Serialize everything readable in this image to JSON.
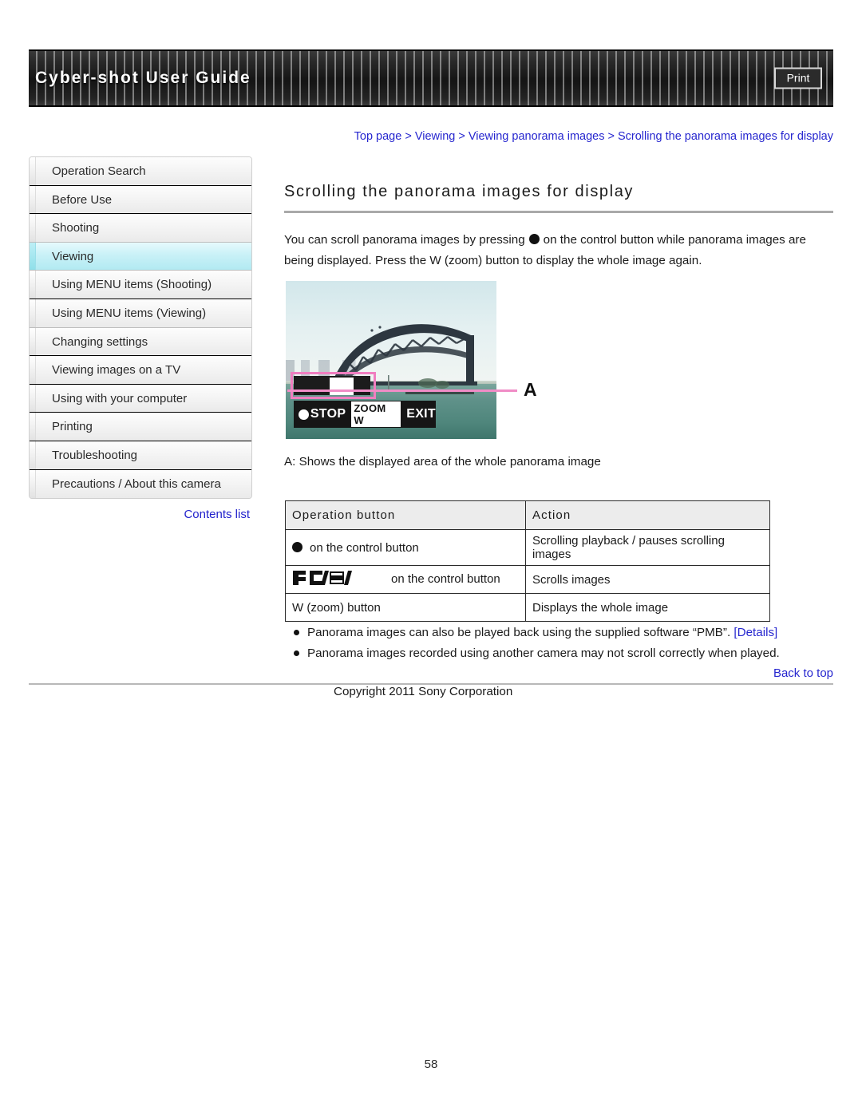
{
  "header": {
    "title": "Cyber-shot User Guide",
    "print_label": "Print"
  },
  "sidebar": {
    "items": [
      {
        "label": "Operation Search",
        "active": false
      },
      {
        "label": "Before Use",
        "active": false
      },
      {
        "label": "Shooting",
        "active": false
      },
      {
        "label": "Viewing",
        "active": true
      },
      {
        "label": "Using MENU items (Shooting)",
        "active": false
      },
      {
        "label": "Using MENU items (Viewing)",
        "active": false
      },
      {
        "label": "Changing settings",
        "active": false
      },
      {
        "label": "Viewing images on a TV",
        "active": false
      },
      {
        "label": "Using with your computer",
        "active": false
      },
      {
        "label": "Printing",
        "active": false
      },
      {
        "label": "Troubleshooting",
        "active": false
      },
      {
        "label": "Precautions / About this camera",
        "active": false
      }
    ],
    "contents_list_label": "Contents list"
  },
  "main": {
    "breadcrumb": "Top page > Viewing > Viewing panorama images > Scrolling the panorama images for display",
    "title": "Scrolling the panorama images for display",
    "intro_part1": "You can scroll panorama images by pressing",
    "intro_part2": "on the control button while panorama images are being displayed. Press the W (zoom) button to display the whole image again.",
    "photo": {
      "osd_stop_label": "STOP",
      "osd_zoom_label": "ZOOM W",
      "osd_exit_label": "EXIT",
      "callout_letter": "A",
      "highlight_color": "#f07ec0"
    },
    "photo_caption": "A: Shows the displayed area of the whole panorama image",
    "table": {
      "headers": [
        "Operation button",
        "Action"
      ],
      "rows": [
        {
          "op_icon": "control-dot-icon",
          "op_text": "on the control button",
          "action": "Scrolling playback / pauses scrolling images"
        },
        {
          "op_icon": "control-arrows-icon",
          "op_text": "on the control button",
          "action": "Scrolls images"
        },
        {
          "op_icon": "",
          "op_text": "W (zoom) button",
          "action": "Displays the whole image"
        }
      ]
    },
    "notes": [
      {
        "text": "Panorama images can also be played back using the supplied software “PMB”.",
        "link": "[Details]"
      },
      {
        "text": "Panorama images recorded using another camera may not scroll correctly when played.",
        "link": ""
      }
    ]
  },
  "footer": {
    "back_to_top": "Back to top",
    "copyright": "Copyright 2011 Sony Corporation",
    "page_number": "58"
  }
}
